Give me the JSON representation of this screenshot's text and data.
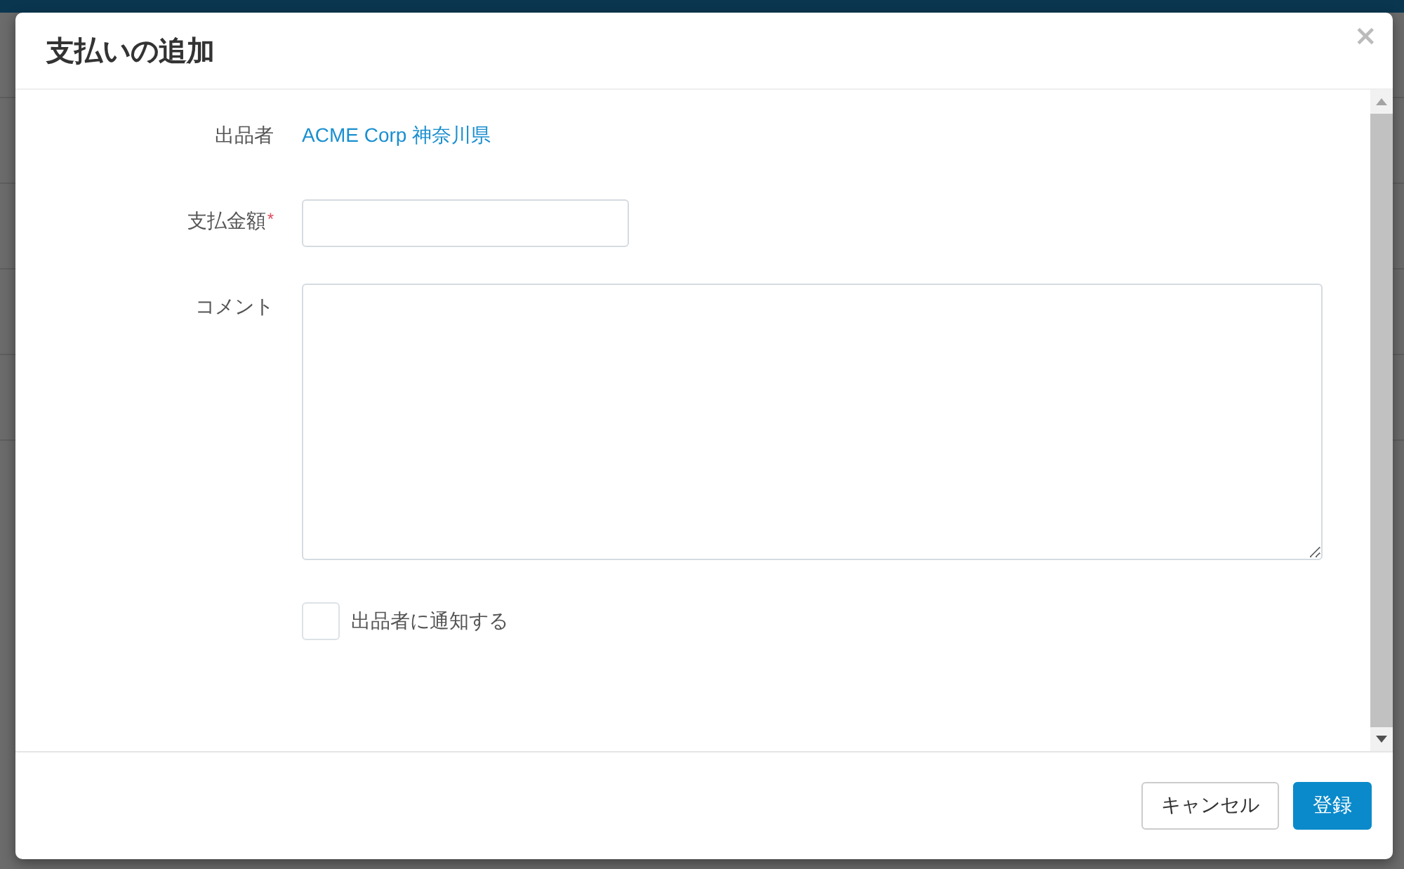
{
  "dialog": {
    "title": "支払いの追加",
    "close": "×"
  },
  "fields": [
    {
      "kind": "link",
      "label": "出品者",
      "value": "ACME Corp 神奈川県"
    },
    {
      "kind": "input",
      "label": "支払金額",
      "required": true,
      "required_mark": "*"
    },
    {
      "kind": "textarea",
      "label": "コメント"
    },
    {
      "kind": "checkbox",
      "label": "出品者に通知する",
      "checked": false
    }
  ],
  "buttons": [
    {
      "label": "キャンセル",
      "kind": "secondary"
    },
    {
      "label": "登録",
      "kind": "primary"
    }
  ]
}
